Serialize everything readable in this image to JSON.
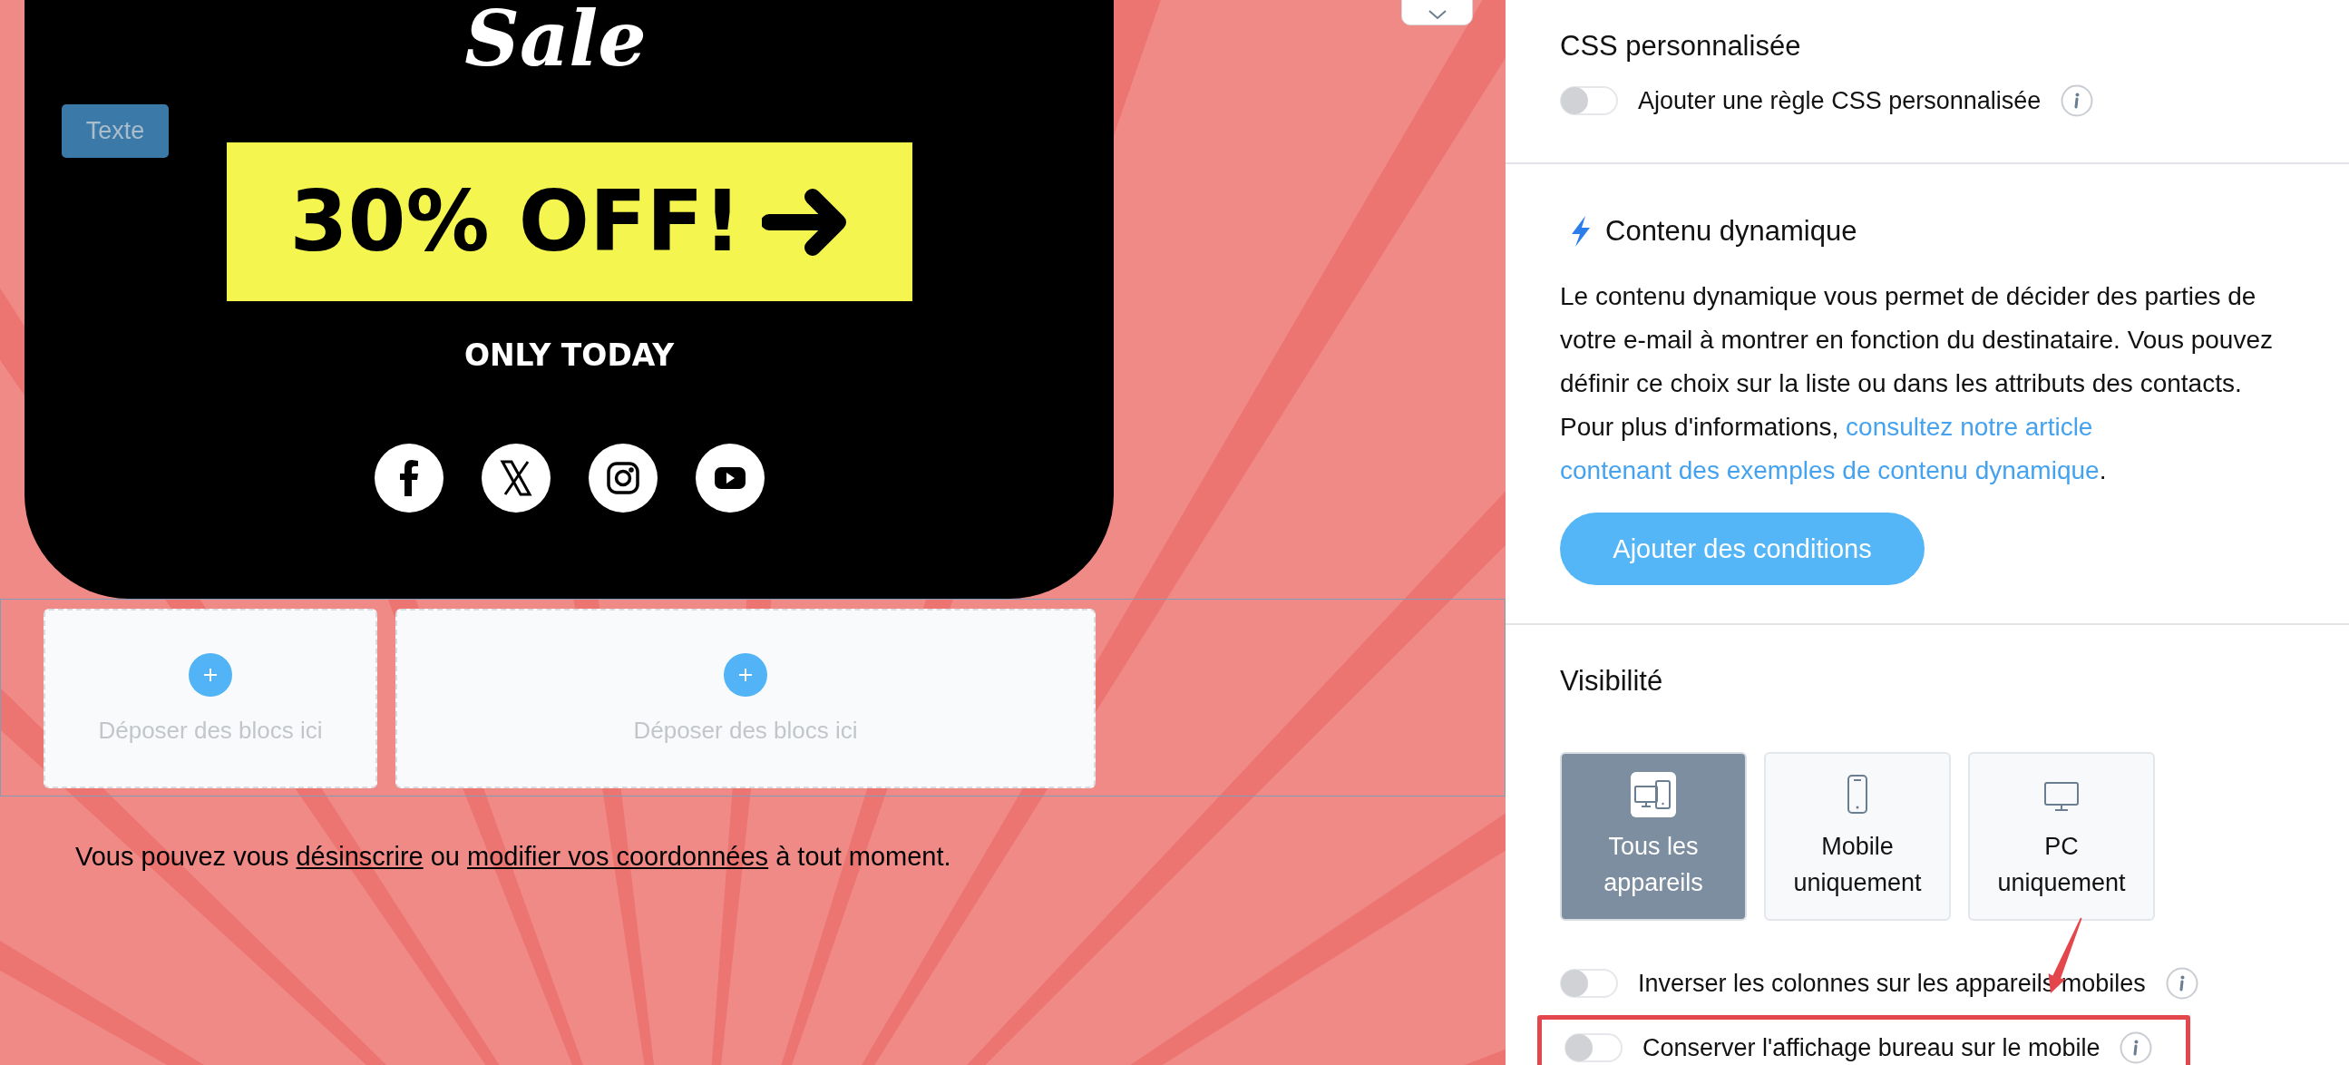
{
  "email": {
    "logo": "Sale",
    "block_tag": "Texte",
    "offer": "30% OFF!",
    "subtitle": "ONLY TODAY",
    "social_icons": [
      {
        "kind": "facebook"
      },
      {
        "kind": "x"
      },
      {
        "kind": "instagram"
      },
      {
        "kind": "youtube"
      }
    ],
    "drop_zones": [
      {
        "label": "Déposer des blocs ici"
      },
      {
        "label": "Déposer des blocs ici"
      }
    ],
    "footer": {
      "before": "Vous pouvez vous ",
      "link_1": "désinscrire",
      "middle": " ou ",
      "link_2": "modifier vos coordonnées",
      "after": " à tout moment."
    }
  },
  "panel": {
    "css": {
      "title": "CSS personnalisée",
      "toggle": {
        "label": "Ajouter une règle CSS personnalisée",
        "on": false
      }
    },
    "dynamic": {
      "title": "Contenu dynamique",
      "text": "Le contenu dynamique vous permet de décider des parties de votre e-mail à montrer en fonction du destinataire. Vous pouvez définir ce choix sur la liste ou dans les attributs des contacts. Pour plus d'informations, ",
      "links": [
        "consultez notre article",
        "contenant des exemples de contenu dynamique"
      ],
      "after": ".",
      "button": "Ajouter des conditions"
    },
    "visibility": {
      "title": "Visibilité",
      "options": [
        {
          "kind": "all",
          "lines": [
            "Tous les",
            "appareils"
          ],
          "selected": true
        },
        {
          "kind": "mobile",
          "lines": [
            "Mobile",
            "uniquement"
          ],
          "selected": false
        },
        {
          "kind": "pc",
          "lines": [
            "PC",
            "uniquement"
          ],
          "selected": false
        }
      ],
      "toggles": [
        {
          "label": "Inverser les colonnes sur les appareils mobiles",
          "on": false,
          "highlighted": false
        },
        {
          "label": "Conserver l'affichage bureau sur le mobile",
          "on": false,
          "highlighted": true
        }
      ]
    }
  }
}
